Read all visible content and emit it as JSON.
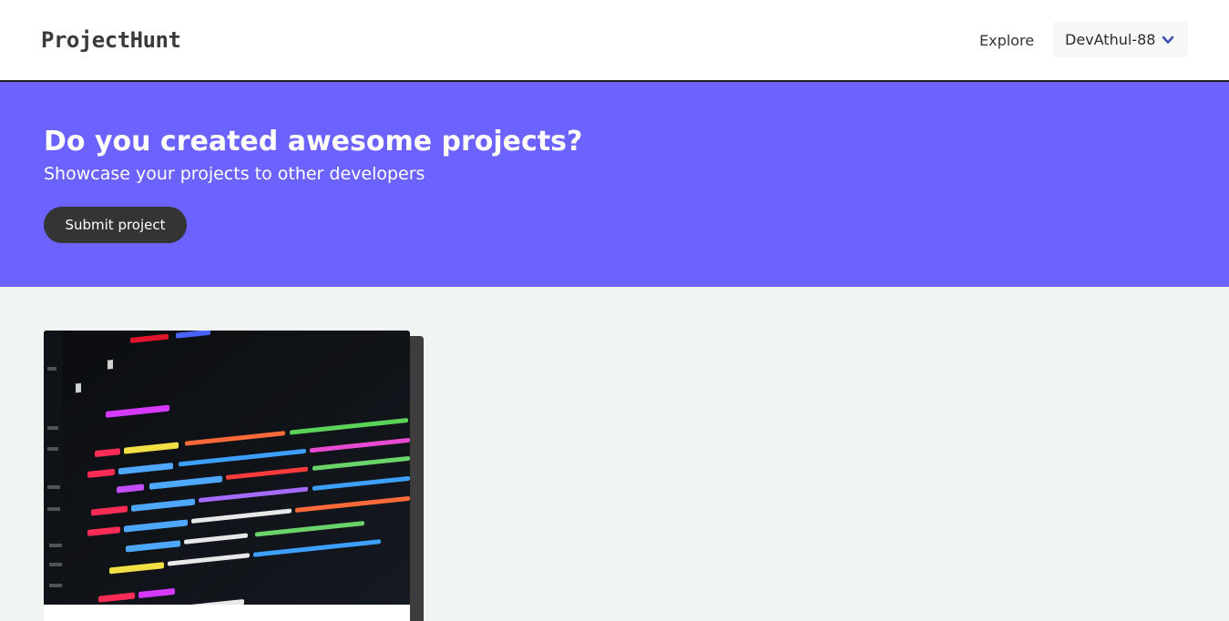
{
  "header": {
    "logo": "ProjectHunt",
    "nav_explore": "Explore",
    "user_menu": {
      "username": "DevAthul-88",
      "icon": "chevron-down-icon"
    }
  },
  "hero": {
    "title": "Do you created awesome projects?",
    "subtitle": "Showcase your projects to other developers",
    "submit_label": "Submit project"
  },
  "colors": {
    "hero_background": "#6c63ff",
    "page_background": "#f0f5f1",
    "button_background": "#343434",
    "chevron": "#3f51b5"
  },
  "cards": [
    {
      "image": "code-screenshot-image"
    }
  ]
}
